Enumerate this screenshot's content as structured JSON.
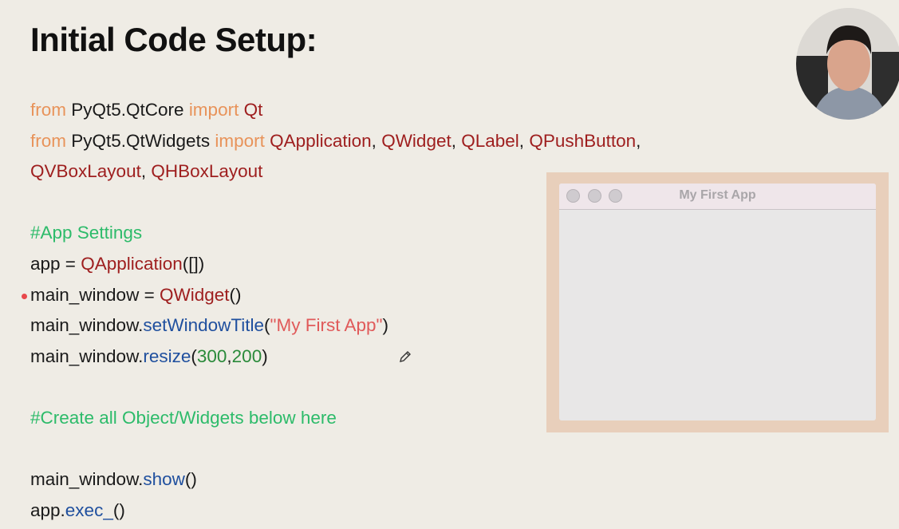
{
  "slide": {
    "title": "Initial Code Setup:"
  },
  "colors": {
    "keyword": "#e8935a",
    "class": "#9e1e1e",
    "plain": "#1a1a1a",
    "comment": "#2dbb6a",
    "method": "#1f4f9e",
    "string": "#e05a5a",
    "number": "#2a8a3a"
  },
  "code": [
    [
      {
        "t": "from ",
        "c": "keyword"
      },
      {
        "t": "PyQt5.QtCore ",
        "c": "plain"
      },
      {
        "t": "import ",
        "c": "keyword"
      },
      {
        "t": "Qt",
        "c": "class"
      }
    ],
    [
      {
        "t": "from ",
        "c": "keyword"
      },
      {
        "t": "PyQt5.QtWidgets ",
        "c": "plain"
      },
      {
        "t": "import ",
        "c": "keyword"
      },
      {
        "t": "QApplication",
        "c": "class"
      },
      {
        "t": ", ",
        "c": "plain"
      },
      {
        "t": "QWidget",
        "c": "class"
      },
      {
        "t": ", ",
        "c": "plain"
      },
      {
        "t": "QLabel",
        "c": "class"
      },
      {
        "t": ", ",
        "c": "plain"
      },
      {
        "t": "QPushButton",
        "c": "class"
      },
      {
        "t": ",",
        "c": "plain"
      }
    ],
    [
      {
        "t": "QVBoxLayout",
        "c": "class"
      },
      {
        "t": ", ",
        "c": "plain"
      },
      {
        "t": "QHBoxLayout",
        "c": "class"
      }
    ],
    [],
    [
      {
        "t": "#App Settings",
        "c": "comment"
      }
    ],
    [
      {
        "t": "app = ",
        "c": "plain"
      },
      {
        "t": "QApplication",
        "c": "class"
      },
      {
        "t": "([])",
        "c": "plain"
      }
    ],
    [
      {
        "t": "main_window = ",
        "c": "plain"
      },
      {
        "t": "QWidget",
        "c": "class"
      },
      {
        "t": "()",
        "c": "plain"
      }
    ],
    [
      {
        "t": "main_window.",
        "c": "plain"
      },
      {
        "t": "setWindowTitle",
        "c": "method"
      },
      {
        "t": "(",
        "c": "plain"
      },
      {
        "t": "\"My First App\"",
        "c": "string"
      },
      {
        "t": ")",
        "c": "plain"
      }
    ],
    [
      {
        "t": "main_window.",
        "c": "plain"
      },
      {
        "t": "resize",
        "c": "method"
      },
      {
        "t": "(",
        "c": "plain"
      },
      {
        "t": "300",
        "c": "number"
      },
      {
        "t": ",",
        "c": "plain"
      },
      {
        "t": "200",
        "c": "number"
      },
      {
        "t": ")",
        "c": "plain"
      }
    ],
    [],
    [
      {
        "t": "#Create all Object/Widgets below here",
        "c": "comment"
      }
    ],
    [],
    [
      {
        "t": "main_window.",
        "c": "plain"
      },
      {
        "t": "show",
        "c": "method"
      },
      {
        "t": "()",
        "c": "plain"
      }
    ],
    [
      {
        "t": "app.",
        "c": "plain"
      },
      {
        "t": "exec_",
        "c": "method"
      },
      {
        "t": "()",
        "c": "plain"
      }
    ]
  ],
  "preview": {
    "window_title": "My First App"
  }
}
